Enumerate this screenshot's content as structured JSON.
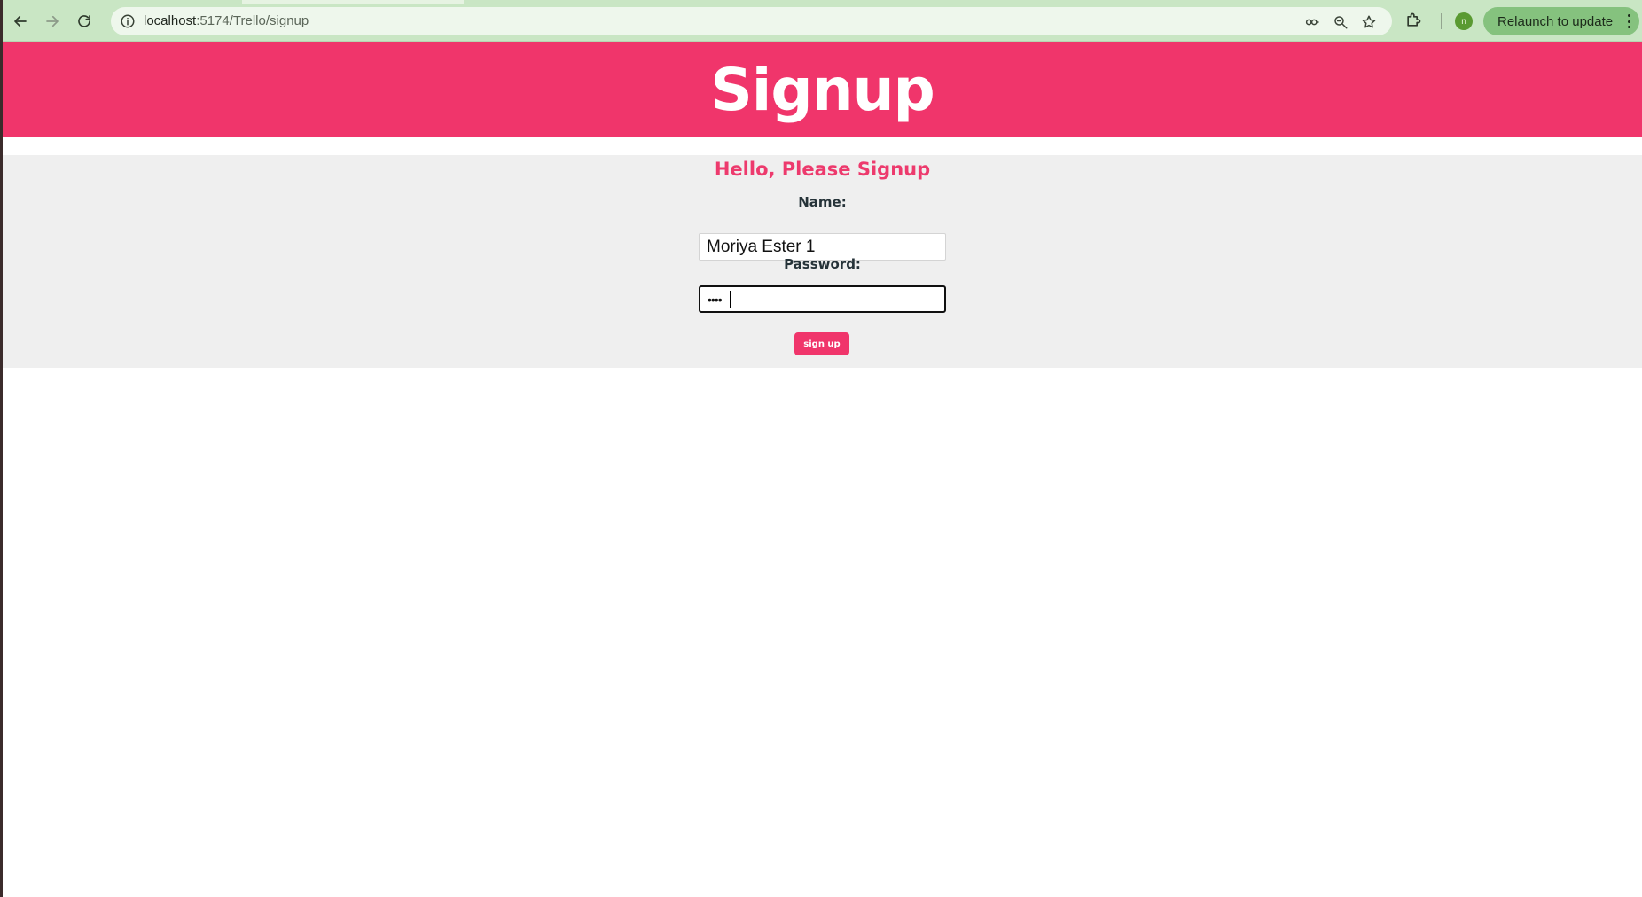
{
  "browser": {
    "url_host": "localhost",
    "url_path": ":5174/Trello/signup",
    "relaunch_label": "Relaunch to update",
    "profile_initial": "n",
    "icons": [
      "back-icon",
      "forward-icon",
      "reload-icon",
      "site-info-icon",
      "password-key-icon",
      "zoom-icon",
      "bookmark-star-icon",
      "extensions-puzzle-icon",
      "kebab-menu-icon"
    ]
  },
  "header": {
    "title": "Signup"
  },
  "form": {
    "greeting": "Hello, Please Signup",
    "name_label": "Name:",
    "name_value": "Moriya Ester 1",
    "password_label": "Password:",
    "password_value": "••••",
    "submit_label": "sign up"
  },
  "colors": {
    "brand": "#f0356b",
    "browser_chrome": "#c9e6c4",
    "relaunch_button": "#85c27e",
    "form_background": "#efefef"
  }
}
